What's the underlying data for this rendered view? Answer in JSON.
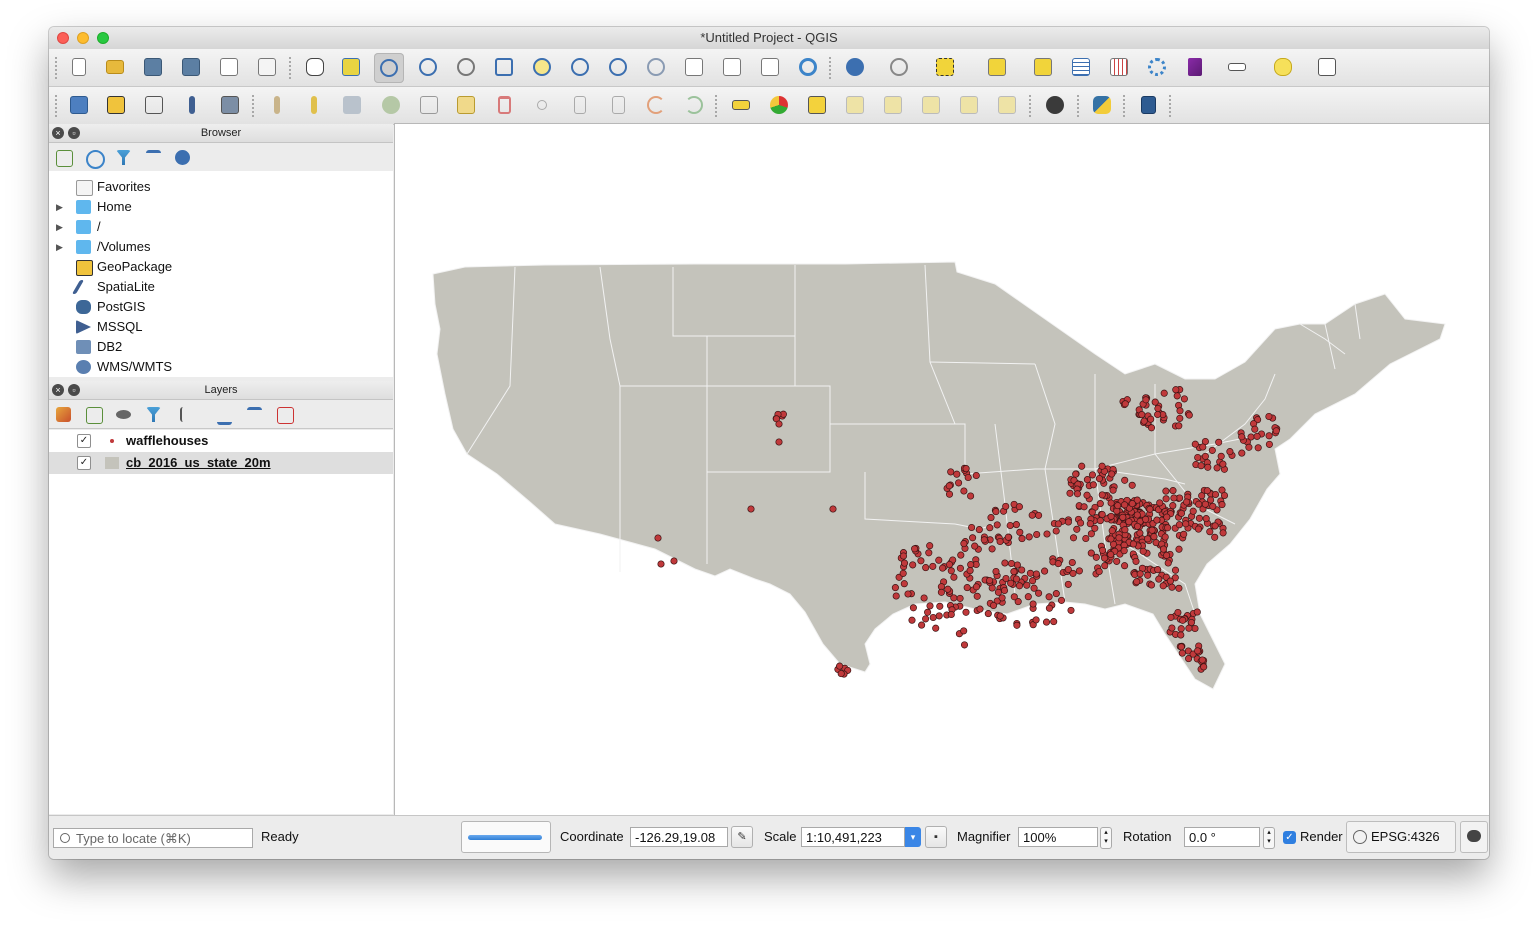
{
  "window": {
    "title": "*Untitled Project - QGIS"
  },
  "browser": {
    "title": "Browser",
    "items": [
      {
        "label": "Favorites",
        "icon": "star-icon",
        "expandable": false
      },
      {
        "label": "Home",
        "icon": "folder-icon",
        "expandable": true
      },
      {
        "label": "/",
        "icon": "folder-icon",
        "expandable": true
      },
      {
        "label": "/Volumes",
        "icon": "folder-icon",
        "expandable": true
      },
      {
        "label": "GeoPackage",
        "icon": "geopackage-icon",
        "expandable": false
      },
      {
        "label": "SpatiaLite",
        "icon": "spatialite-icon",
        "expandable": false
      },
      {
        "label": "PostGIS",
        "icon": "postgis-icon",
        "expandable": false
      },
      {
        "label": "MSSQL",
        "icon": "mssql-icon",
        "expandable": false
      },
      {
        "label": "DB2",
        "icon": "db2-icon",
        "expandable": false
      },
      {
        "label": "WMS/WMTS",
        "icon": "globe-icon",
        "expandable": false
      }
    ]
  },
  "layers": {
    "title": "Layers",
    "items": [
      {
        "label": "wafflehouses",
        "checked": true,
        "symbol": "point"
      },
      {
        "label": "cb_2016_us_state_20m",
        "checked": true,
        "symbol": "polygon"
      }
    ]
  },
  "status": {
    "locate_placeholder": "Type to locate (⌘K)",
    "message": "Ready",
    "coordinate_label": "Coordinate",
    "coordinate_value": "-126.29,19.08",
    "scale_label": "Scale",
    "scale_value": "1:10,491,223",
    "magnifier_label": "Magnifier",
    "magnifier_value": "100%",
    "rotation_label": "Rotation",
    "rotation_value": "0.0 °",
    "render_label": "Render",
    "render_checked": true,
    "crs": "EPSG:4326"
  },
  "colors": {
    "land": "#c4c3bb",
    "state_border": "#f2f2f2",
    "point_fill": "#c0393b",
    "point_stroke": "#3a1414"
  }
}
